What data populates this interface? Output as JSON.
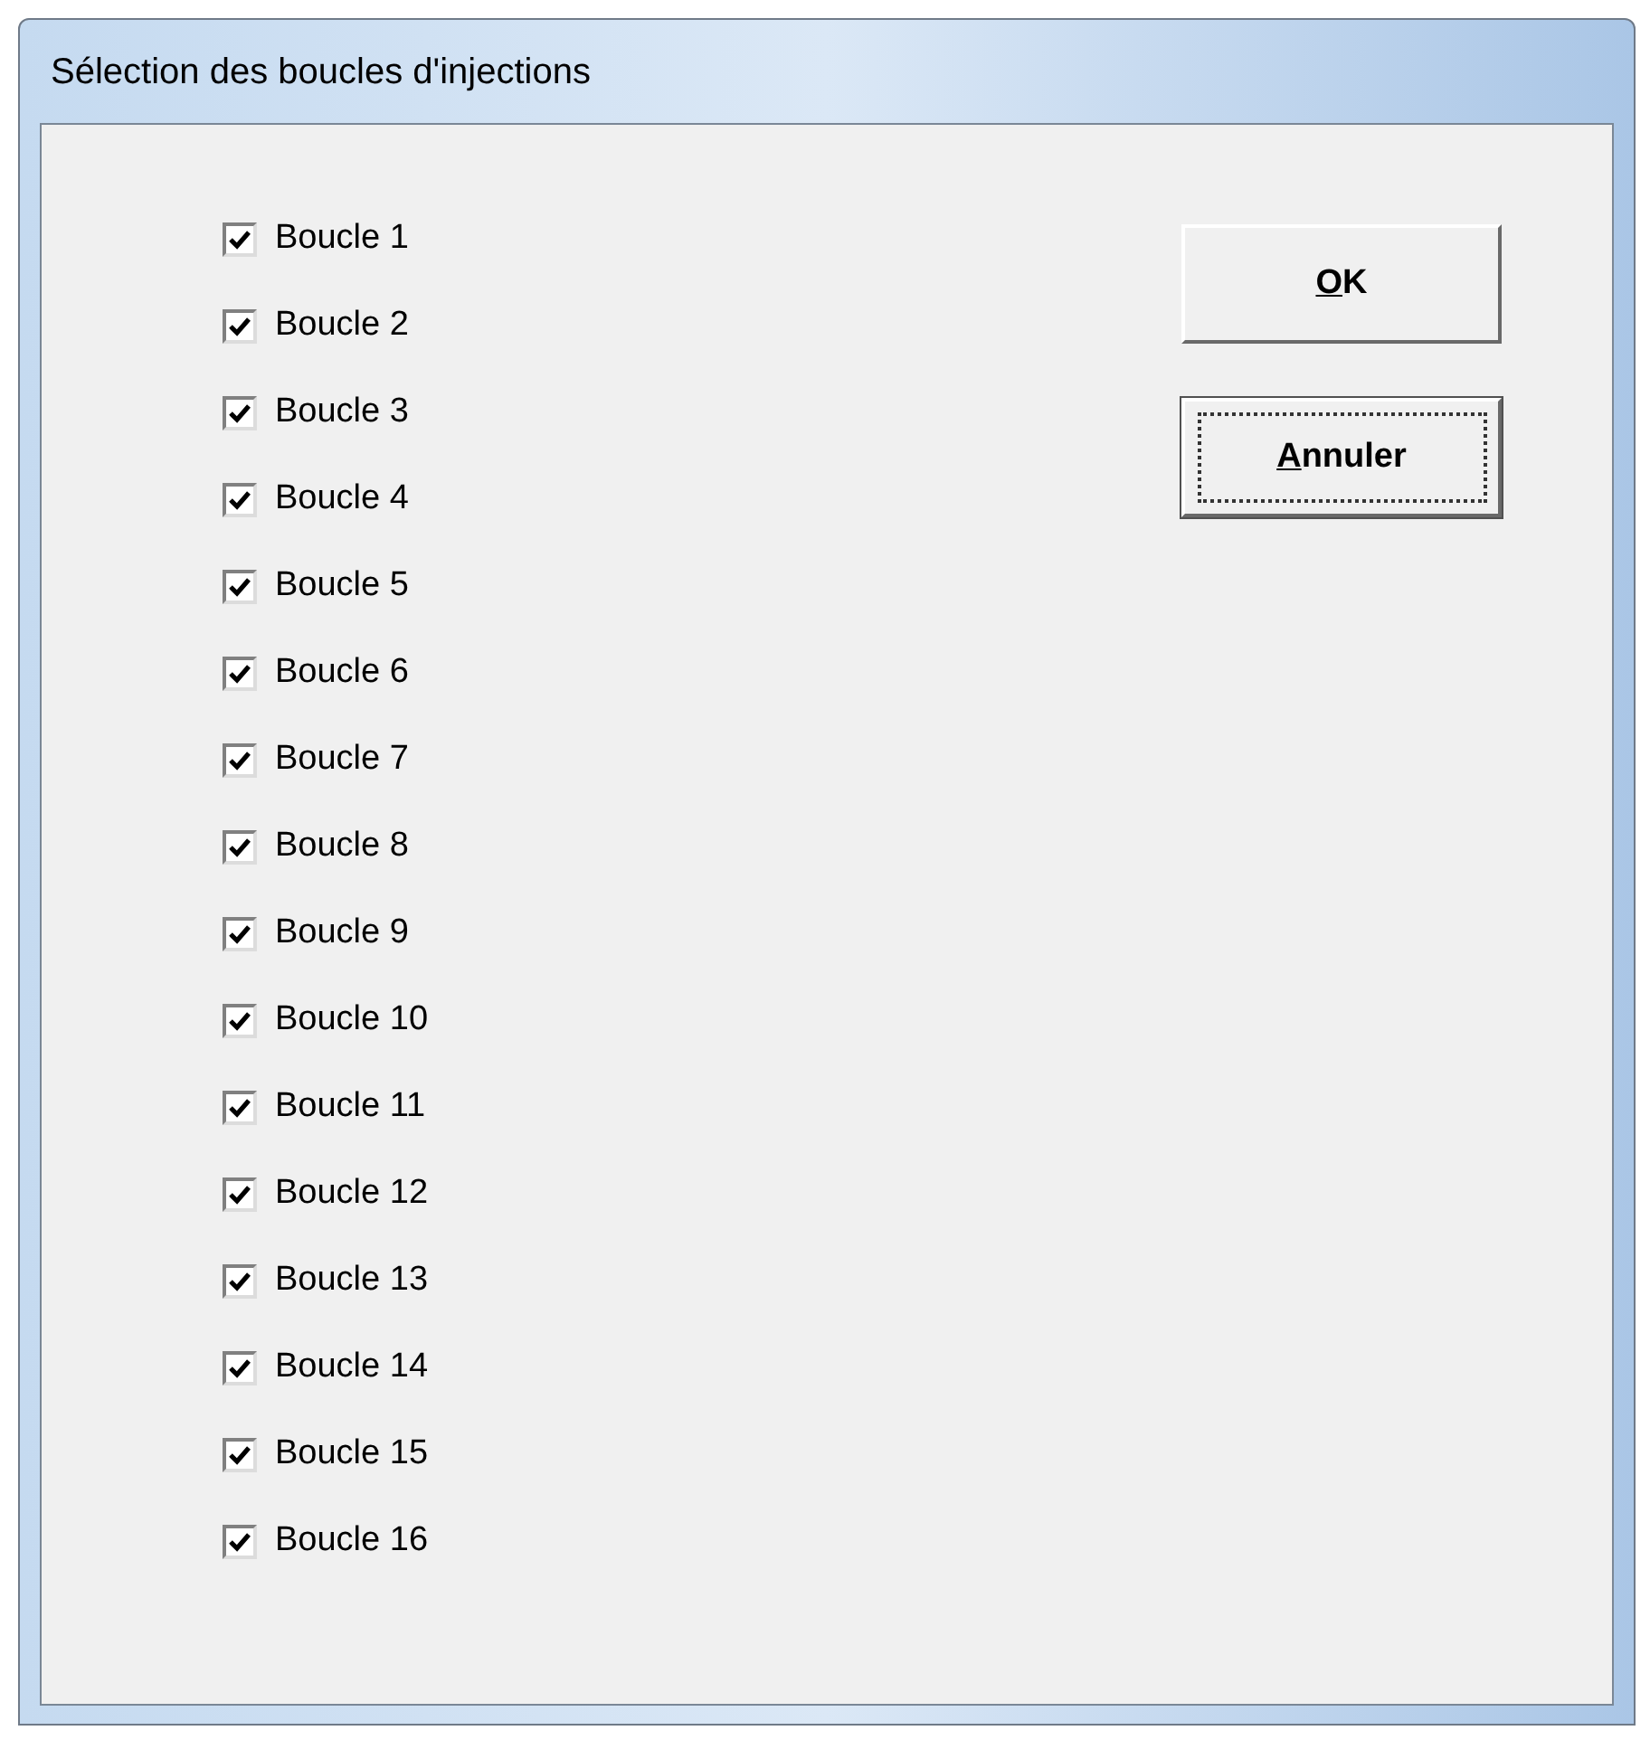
{
  "window": {
    "title": "Sélection des boucles d'injections"
  },
  "loops": [
    {
      "label": "Boucle 1",
      "checked": true
    },
    {
      "label": "Boucle 2",
      "checked": true
    },
    {
      "label": "Boucle 3",
      "checked": true
    },
    {
      "label": "Boucle 4",
      "checked": true
    },
    {
      "label": "Boucle 5",
      "checked": true
    },
    {
      "label": "Boucle 6",
      "checked": true
    },
    {
      "label": "Boucle 7",
      "checked": true
    },
    {
      "label": "Boucle 8",
      "checked": true
    },
    {
      "label": "Boucle 9",
      "checked": true
    },
    {
      "label": "Boucle 10",
      "checked": true
    },
    {
      "label": "Boucle 11",
      "checked": true
    },
    {
      "label": "Boucle 12",
      "checked": true
    },
    {
      "label": "Boucle 13",
      "checked": true
    },
    {
      "label": "Boucle 14",
      "checked": true
    },
    {
      "label": "Boucle 15",
      "checked": true
    },
    {
      "label": "Boucle 16",
      "checked": true
    }
  ],
  "buttons": [
    {
      "label": "OK",
      "focused": false,
      "mnemonic": true
    },
    {
      "label": "Annuler",
      "focused": true,
      "mnemonic": true
    }
  ]
}
